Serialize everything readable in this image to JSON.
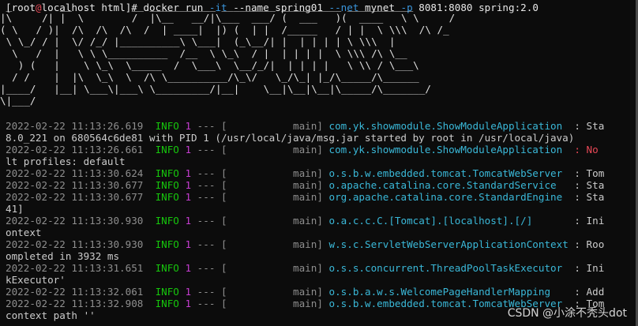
{
  "prompt": {
    "open": "[",
    "user": "root",
    "at": "@",
    "host": "localhost",
    "dir": " html]# ",
    "cmd_pre": "docker run ",
    "flag_it": "-it",
    "name_pre": " --name spring01 ",
    "flag_net": "--net",
    "net_val": " mynet ",
    "flag_p": "-p",
    "rest": " 8081:8080 spring:2.0"
  },
  "banner": [
    " _        __          __ ___________ _________ __________ ___________",
    "|\\     /| |  \\        /  |\\__   __/|\\___  ___/ (  ___   )(  ____   \\ \\     /",
    "( \\   / )|  /\\  /\\  /\\  /  | ____|  |) (  | |  /_____   / | |  \\ \\\\\\  /\\ /_",
    " \\ \\_/ / |  \\/ /_/ |__________\\ \\___|  (_\\__/| |  | | | | \\ \\\\\\  |",
    "  \\   /  |   \\ \\ \\__________  /__  \\ \\_\\  / |  | | | |  \\ \\\\\\ /\\ \\__",
    "   ) (   |    \\ \\_\\  \\_____  /  \\___\\  \\__/_/|  | | | |   \\ \\\\ / \\___\\",
    "  / /    |  |\\  \\_\\  \\  /\\ \\__________/\\_\\/   \\_/\\_| |_/\\_____/\\______",
    "|____/   |__| \\___\\|___\\ \\_________/|__|    \\__|\\__|\\__|\\_____/\\_______/",
    "\\|___/"
  ],
  "logs": [
    {
      "ts": "2022-02-22 11:13:26.619",
      "level": "INFO",
      "pid": "1",
      "thread": "main",
      "logger": "com.yk.showmodule.ShowModuleApplication",
      "msg": "  : Sta",
      "warn": false
    },
    {
      "cont": "8.0_221 on 680564c6de81 with PID 1 (/usr/local/java/msg.jar started by root in /usr/local/java)"
    },
    {
      "ts": "2022-02-22 11:13:26.661",
      "level": "INFO",
      "pid": "1",
      "thread": "main",
      "logger": "com.yk.showmodule.ShowModuleApplication",
      "msg": "  : No",
      "warn": true
    },
    {
      "cont": "lt profiles: default"
    },
    {
      "ts": "2022-02-22 11:13:30.624",
      "level": "INFO",
      "pid": "1",
      "thread": "main",
      "logger": "o.s.b.w.embedded.tomcat.TomcatWebServer",
      "msg": "  : Tom",
      "warn": false
    },
    {
      "ts": "2022-02-22 11:13:30.677",
      "level": "INFO",
      "pid": "1",
      "thread": "main",
      "logger": "o.apache.catalina.core.StandardService",
      "msg": "   : Sta",
      "warn": false
    },
    {
      "ts": "2022-02-22 11:13:30.677",
      "level": "INFO",
      "pid": "1",
      "thread": "main",
      "logger": "org.apache.catalina.core.StandardEngine",
      "msg": "  : Sta",
      "warn": false
    },
    {
      "cont": "41]"
    },
    {
      "ts": "2022-02-22 11:13:30.930",
      "level": "INFO",
      "pid": "1",
      "thread": "main",
      "logger": "o.a.c.c.C.[Tomcat].[localhost].[/]",
      "msg": "       : Ini",
      "warn": false
    },
    {
      "cont": "ontext"
    },
    {
      "ts": "2022-02-22 11:13:30.930",
      "level": "INFO",
      "pid": "1",
      "thread": "main",
      "logger": "w.s.c.ServletWebServerApplicationContext",
      "msg": " : Roo",
      "warn": false
    },
    {
      "cont": "ompleted in 3932 ms"
    },
    {
      "ts": "2022-02-22 11:13:31.651",
      "level": "INFO",
      "pid": "1",
      "thread": "main",
      "logger": "o.s.s.concurrent.ThreadPoolTaskExecutor",
      "msg": "  : Ini",
      "warn": false
    },
    {
      "cont": "kExecutor'"
    },
    {
      "ts": "2022-02-22 11:13:32.061",
      "level": "INFO",
      "pid": "1",
      "thread": "main",
      "logger": "o.s.b.a.w.s.WelcomePageHandlerMapping",
      "msg": "    : Add",
      "warn": false
    },
    {
      "ts": "2022-02-22 11:13:32.908",
      "level": "INFO",
      "pid": "1",
      "thread": "main",
      "logger": "o.s.b.w.embedded.tomcat.TomcatWebServer",
      "msg": "  : Tom",
      "warn": false
    },
    {
      "cont": "context path ''"
    }
  ],
  "watermark": "CSDN @小涂不秃头dot"
}
